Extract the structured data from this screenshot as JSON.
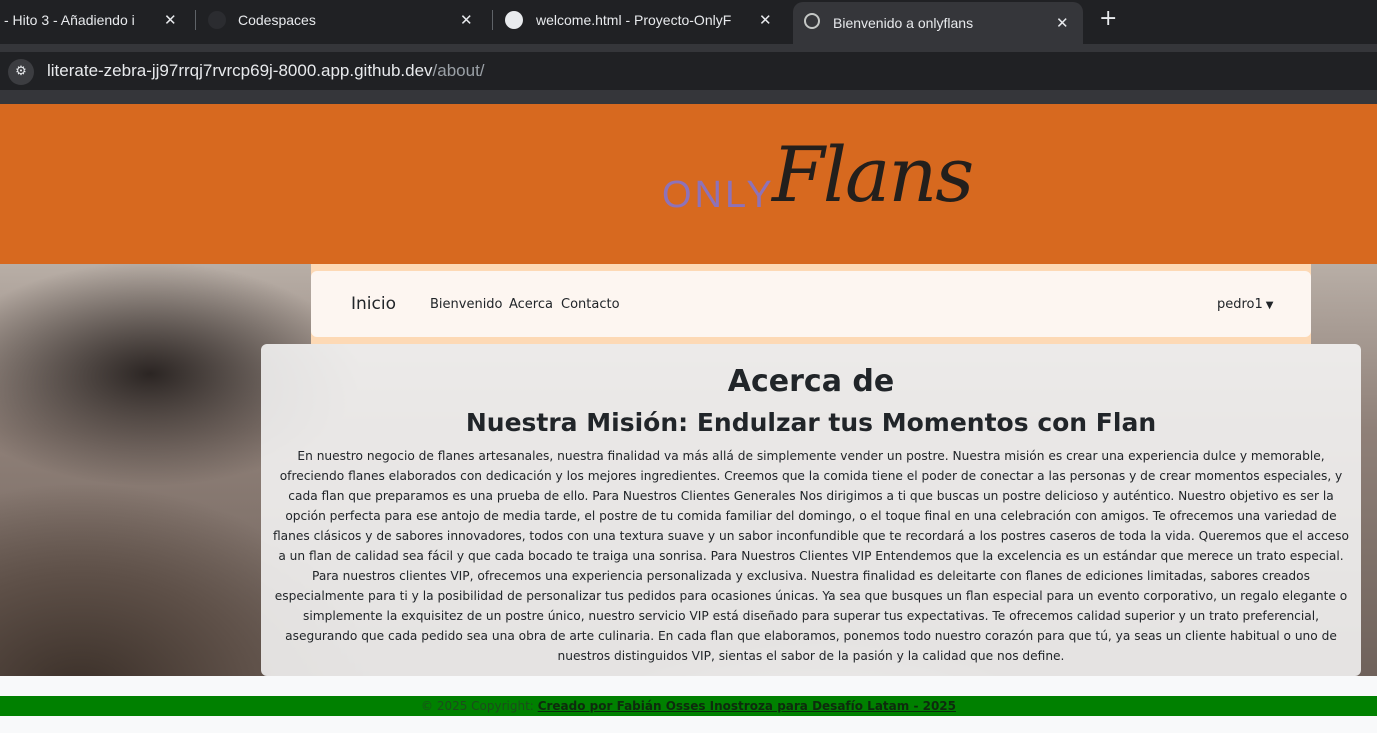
{
  "browser": {
    "tabs": [
      {
        "title": "- Hito 3 - Añadiendo i",
        "close": "✕"
      },
      {
        "title": "Codespaces",
        "close": "✕"
      },
      {
        "title": "welcome.html - Proyecto-OnlyF",
        "close": "✕"
      },
      {
        "title": "Bienvenido a onlyflans",
        "close": "✕"
      }
    ],
    "new_tab": "+",
    "url_host": "literate-zebra-jj97rrqj7rvrcp69j-8000.app.github.dev",
    "url_path": "/about/"
  },
  "logo": {
    "only": "ONLY",
    "flans": "Flans"
  },
  "navbar": {
    "brand": "Inicio",
    "links": [
      "Bienvenido",
      "Acerca",
      "Contacto"
    ],
    "user": "pedro1"
  },
  "main": {
    "title": "Acerca de",
    "subtitle": "Nuestra Misión: Endulzar tus Momentos con Flan",
    "body": "En nuestro negocio de flanes artesanales, nuestra finalidad va más allá de simplemente vender un postre. Nuestra misión es crear una experiencia dulce y memorable, ofreciendo flanes elaborados con dedicación y los mejores ingredientes. Creemos que la comida tiene el poder de conectar a las personas y de crear momentos especiales, y cada flan que preparamos es una prueba de ello. Para Nuestros Clientes Generales Nos dirigimos a ti que buscas un postre delicioso y auténtico. Nuestro objetivo es ser la opción perfecta para ese antojo de media tarde, el postre de tu comida familiar del domingo, o el toque final en una celebración con amigos. Te ofrecemos una variedad de flanes clásicos y de sabores innovadores, todos con una textura suave y un sabor inconfundible que te recordará a los postres caseros de toda la vida. Queremos que el acceso a un flan de calidad sea fácil y que cada bocado te traiga una sonrisa. Para Nuestros Clientes VIP Entendemos que la excelencia es un estándar que merece un trato especial. Para nuestros clientes VIP, ofrecemos una experiencia personalizada y exclusiva. Nuestra finalidad es deleitarte con flanes de ediciones limitadas, sabores creados especialmente para ti y la posibilidad de personalizar tus pedidos para ocasiones únicas. Ya sea que busques un flan especial para un evento corporativo, un regalo elegante o simplemente la exquisitez de un postre único, nuestro servicio VIP está diseñado para superar tus expectativas. Te ofrecemos calidad superior y un trato preferencial, asegurando que cada pedido sea una obra de arte culinaria. En cada flan que elaboramos, ponemos todo nuestro corazón para que tú, ya seas un cliente habitual o uno de nuestros distinguidos VIP, sientas el sabor de la pasión y la calidad que nos define."
  },
  "footer": {
    "copyright": "© 2025 Copyright:",
    "credit": "Creado por Fabián Osses Inostroza para Desafío Latam - 2025"
  },
  "colors": {
    "header": "#d7691f",
    "navbar_outer": "#fdd9b5",
    "navbar_inner": "#fdf6f1",
    "footer": "#008000"
  }
}
